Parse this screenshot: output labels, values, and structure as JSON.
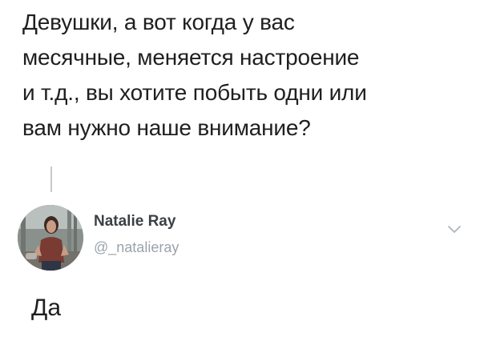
{
  "quoted_tweet": {
    "lines": [
      "Девушки, а вот когда у вас",
      "месячные, меняется настроение",
      "и т.д., вы хотите побыть одни или",
      "вам нужно наше внимание?"
    ]
  },
  "author": {
    "name": "Natalie Ray",
    "handle": "@_natalieray"
  },
  "reply": {
    "text": "Да"
  },
  "icons": {
    "chevron": "chevron-down-icon",
    "avatar": "avatar-photo"
  }
}
